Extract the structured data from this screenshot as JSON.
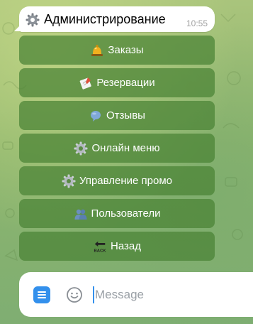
{
  "message": {
    "title": "Администрирование",
    "time": "10:55",
    "icon": "gear-icon"
  },
  "keyboard": {
    "buttons": [
      {
        "label": "Заказы",
        "icon": "bell-icon"
      },
      {
        "label": "Резервации",
        "icon": "memo-icon"
      },
      {
        "label": "Отзывы",
        "icon": "speech-bubble-icon"
      },
      {
        "label": "Онлайн меню",
        "icon": "gear-icon"
      },
      {
        "label": "Управление промо",
        "icon": "gear-icon"
      },
      {
        "label": "Пользователи",
        "icon": "users-icon"
      },
      {
        "label": "Назад",
        "icon": "back-arrow-icon",
        "icon_text": "BACK"
      }
    ]
  },
  "composer": {
    "placeholder": "Message",
    "menu_icon": "menu-icon",
    "emoji_icon": "smiley-icon"
  },
  "colors": {
    "button_bg": "#4a8234",
    "accent": "#3390ec",
    "bubble_bg": "#ffffff"
  }
}
